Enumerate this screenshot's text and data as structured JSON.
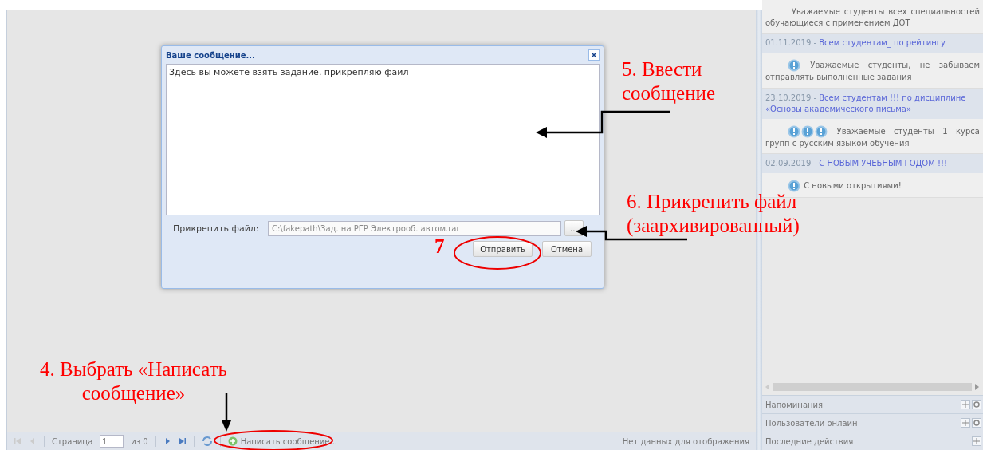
{
  "dialog": {
    "title": "Ваше сообщение...",
    "message": "Здесь вы можете взять задание. прикрепляю файл",
    "attach_label": "Прикрепить файл:",
    "attach_value": "C:\\fakepath\\Зад. на РГР Электрооб. автом.rar",
    "browse_button": "...",
    "buttons": [
      "Отправить",
      "Отмена"
    ]
  },
  "toolbar": {
    "page_label": "Страница",
    "page_value": "1",
    "page_total": "из 0",
    "compose": "Написать сообщение...",
    "status": "Нет данных для отображения"
  },
  "news": [
    {
      "kind": "plain",
      "text": "Уважаемые студенты всех специальностей обучающиеся с применением ДОТ"
    },
    {
      "kind": "single",
      "date": "01.11.2019 -",
      "title": "Всем студентам_ по рейтингу",
      "text": "Уважаемые студенты, не забываем отправлять выполненные задания"
    },
    {
      "kind": "triple",
      "date": "23.10.2019 -",
      "title": "Всем студентам !!! по дисциплине «Основы академического письма»",
      "text": "Уважаемые студенты 1 курса групп с русским языком обучения"
    },
    {
      "kind": "single",
      "date": "02.09.2019 -",
      "title": "С НОВЫМ УЧЕБНЫМ ГОДОМ !!!",
      "text": "С новыми открытиями!"
    }
  ],
  "panels": [
    {
      "kind": "full",
      "title": "Напоминания"
    },
    {
      "kind": "full",
      "title": "Пользователи онлайн"
    },
    {
      "kind": "add-only",
      "title": "Последние действия"
    }
  ],
  "annotations": [
    {
      "kind": "step",
      "text": "5. Ввести\nсообщение"
    },
    {
      "kind": "step",
      "text": "6. Прикрепить файл\n(заархивированный)"
    },
    {
      "kind": "number",
      "text": "7"
    },
    {
      "kind": "step",
      "text": "4. Выбрать «Написать\nсообщение»"
    }
  ]
}
